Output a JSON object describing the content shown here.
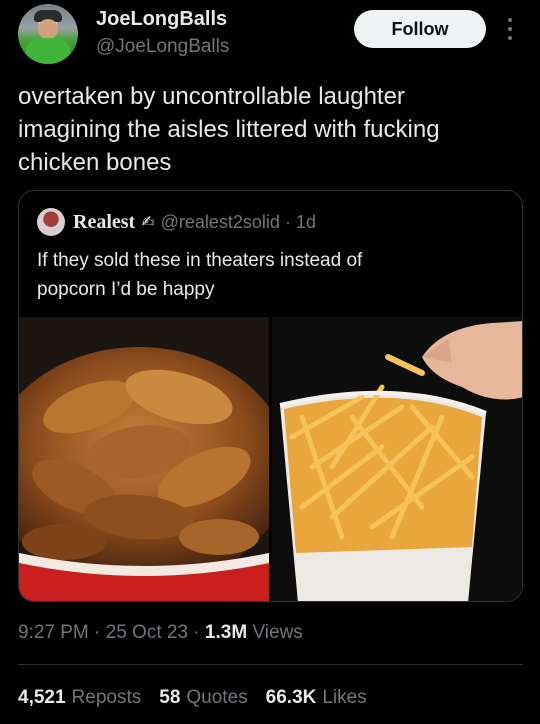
{
  "author": {
    "display_name": "JoeLongBalls",
    "handle": "@JoeLongBalls",
    "follow_label": "Follow"
  },
  "tweet": {
    "text": "overtaken by uncontrollable laughter\nimagining the aisles littered with fucking\nchicken bones"
  },
  "quoted": {
    "name": "Realest",
    "emoji": "✍",
    "handle_time": "@realest2solid · 1d",
    "text": "If they sold these in theaters instead of\npopcorn I’d be happy"
  },
  "meta": {
    "time": "9:27 PM · 25 Oct 23 · ",
    "views_count": "1.3M",
    "views_label": " Views"
  },
  "stats": {
    "reposts_count": "4,521",
    "reposts_label": "Reposts",
    "quotes_count": "58",
    "quotes_label": "Quotes",
    "likes_count": "66.3K",
    "likes_label": "Likes"
  },
  "colors": {
    "background": "#000000",
    "text": "#e7e9ea",
    "secondary": "#71767b",
    "border": "#2f3336"
  }
}
